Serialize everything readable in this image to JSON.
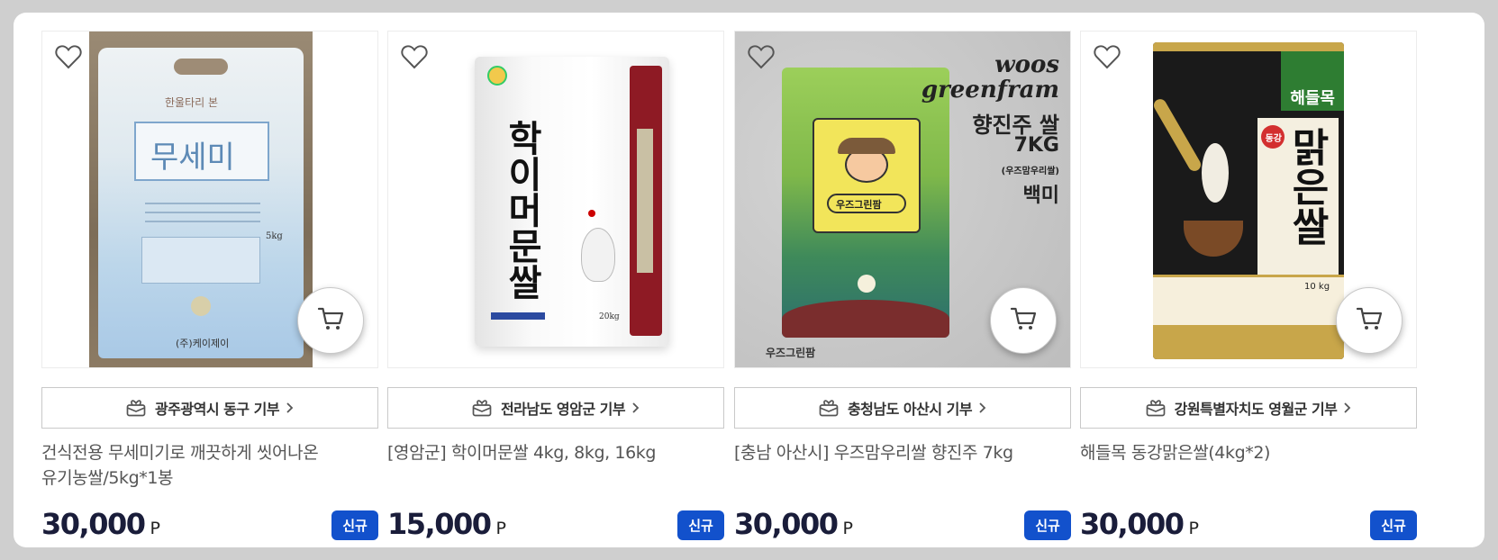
{
  "products": [
    {
      "donation": "광주광역시 동구 기부",
      "name_lines": [
        "건식전용 무세미기로 깨끗하게 씻어나온",
        "유기농쌀/5kg*1봉"
      ],
      "price": "30,000",
      "unit": "P",
      "badge": "신규",
      "package_text": {
        "brand": "한울타리 본",
        "main": "무세미",
        "weight": "5kg",
        "maker": "(주)케이제이"
      }
    },
    {
      "donation": "전라남도 영암군 기부",
      "name_lines": [
        "[영암군] 학이머문쌀 4kg, 8kg, 16kg"
      ],
      "price": "15,000",
      "unit": "P",
      "badge": "신규",
      "package_text": {
        "main": "학이머문쌀",
        "weight": "20kg"
      }
    },
    {
      "donation": "충청남도 아산시 기부",
      "name_lines": [
        "[충남 아산시] 우즈맘우리쌀 향진주 7kg"
      ],
      "price": "30,000",
      "unit": "P",
      "badge": "신규",
      "package_text": {
        "brand1": "woos",
        "brand2": "greenfram",
        "line1": "향진주 쌀",
        "line2": "7KG",
        "line3": "(우즈맘우리쌀)",
        "line4": "백미",
        "label": "우즈그린팜",
        "logo": "우즈그린팜"
      }
    },
    {
      "donation": "강원특별자치도 영월군 기부",
      "name_lines": [
        "해들목 동강맑은쌀(4kg*2)"
      ],
      "price": "30,000",
      "unit": "P",
      "badge": "신규",
      "package_text": {
        "brand": "해들목",
        "tag": "동강",
        "main": "맑은쌀",
        "weight": "10 kg"
      }
    }
  ],
  "icons": {
    "wishlist": "heart-outline-icon",
    "cart": "cart-icon",
    "donation": "gift-box-icon",
    "arrow": "chevron-right-icon"
  },
  "colors": {
    "badge_bg": "#1251cc",
    "price_text": "#1a1d3a",
    "page_bg": "#cfcfcf"
  }
}
